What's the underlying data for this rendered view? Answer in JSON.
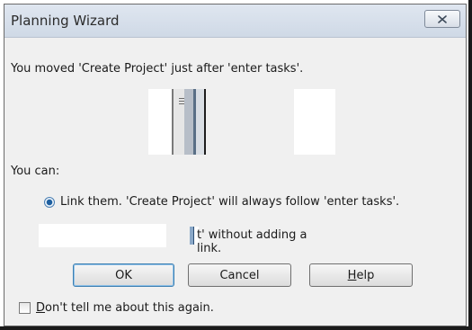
{
  "dialog": {
    "title": "Planning Wizard",
    "close_icon": "close-icon",
    "message": "You moved 'Create Project' just after 'enter tasks'.",
    "you_can": "You can:",
    "option_link": {
      "label": "Link them. 'Create Project' will always follow 'enter tasks'.",
      "selected": true
    },
    "option_move_partial": "t' without adding a link.",
    "buttons": {
      "ok": "OK",
      "cancel": "Cancel",
      "help_rest": "elp",
      "help_mnemonic": "H"
    },
    "dont_tell": {
      "mnemonic": "D",
      "rest": "on't tell me about this again.",
      "checked": false
    }
  },
  "colors": {
    "accent": "#3c7fb1",
    "titlebar": "#d5dee9",
    "dialog_bg": "#f0f0f0"
  }
}
